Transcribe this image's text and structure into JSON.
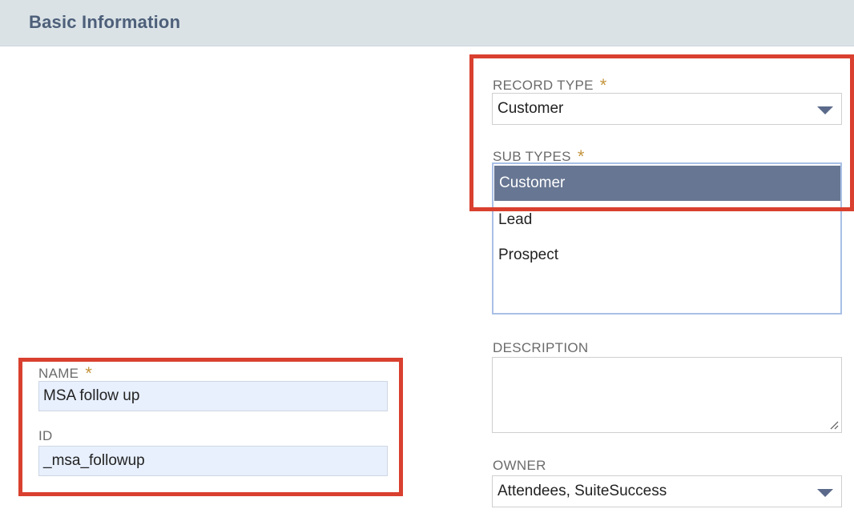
{
  "section": {
    "title": "Basic Information"
  },
  "record_type": {
    "label": "RECORD TYPE",
    "required_mark": "*",
    "value": "Customer",
    "icon": "chevron-down-icon"
  },
  "sub_types": {
    "label": "SUB TYPES",
    "required_mark": "*",
    "options": [
      "Customer",
      "Lead",
      "Prospect"
    ],
    "selected": "Customer"
  },
  "description": {
    "label": "DESCRIPTION",
    "value": ""
  },
  "owner": {
    "label": "OWNER",
    "value": "Attendees, SuiteSuccess",
    "icon": "chevron-down-icon"
  },
  "name": {
    "label": "NAME",
    "required_mark": "*",
    "value": "MSA follow up"
  },
  "id_field": {
    "label": "ID",
    "value": "_msa_followup"
  },
  "colors": {
    "header_bg": "#dae2e6",
    "header_text": "#4d5f79",
    "required": "#c5953e",
    "selected_option_bg": "#677692",
    "input_autofill_bg": "#e8f0fe",
    "annotation_box": "#d9402f"
  }
}
